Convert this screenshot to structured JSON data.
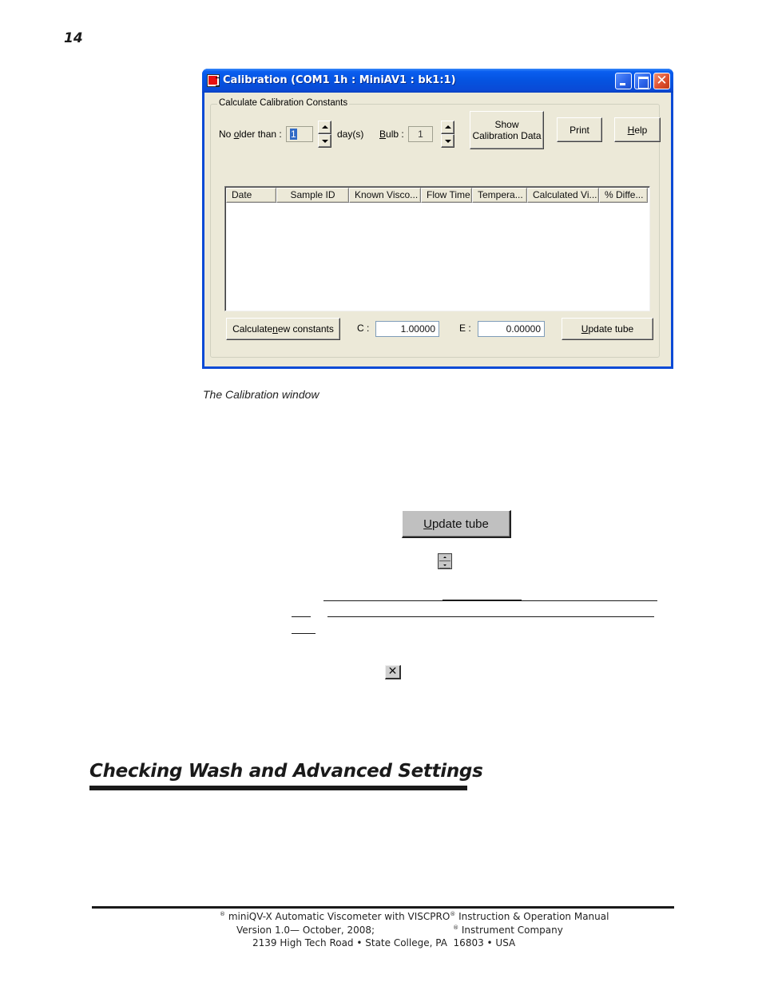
{
  "page": {
    "number": "14",
    "caption": "The Calibration window",
    "section_heading": "Checking Wash and Advanced Settings"
  },
  "window": {
    "title": "Calibration (COM1 1h : MiniAV1 : bk1:1)",
    "close_glyph": "✕",
    "groupbox_label": "Calculate Calibration Constants",
    "no_older_than": {
      "label_pre": "No ",
      "label_accel": "o",
      "label_post": "lder than :",
      "value": "1",
      "unit": "day(s)"
    },
    "bulb": {
      "label_accel": "B",
      "label_post": "ulb :",
      "value": "1"
    },
    "buttons": {
      "show_calibration_line1": "Show",
      "show_calibration_line2": "Calibration Data",
      "print": "Print",
      "help_accel": "H",
      "help_rest": "elp",
      "calculate_pre": "Calculate ",
      "calculate_accel": "n",
      "calculate_post": "ew constants",
      "update_accel": "U",
      "update_rest": "pdate tube"
    },
    "table": {
      "columns": [
        "Date",
        "Sample ID",
        "Known Visco...",
        "Flow Time",
        "Tempera...",
        "Calculated Vi...",
        "% Diffe..."
      ],
      "rows": []
    },
    "constants": {
      "c_label": "C :",
      "c_value": "1.00000",
      "e_label": "E :",
      "e_value": "0.00000"
    }
  },
  "inline_images": {
    "update_button_accel": "U",
    "update_button_rest": "pdate tube",
    "close_glyph": "✕"
  },
  "footer": {
    "line1_pre": "®",
    "line1_a": " miniQV-X Automatic Viscometer with VISCPRO",
    "line1_b": "®",
    "line1_c": " Instruction & Operation Manual",
    "line2_a": "Version 1.0— October, 2008;",
    "line2_b": "®",
    "line2_c": " Instrument Company",
    "line3": "2139 High Tech Road • State College, PA  16803 • USA"
  }
}
